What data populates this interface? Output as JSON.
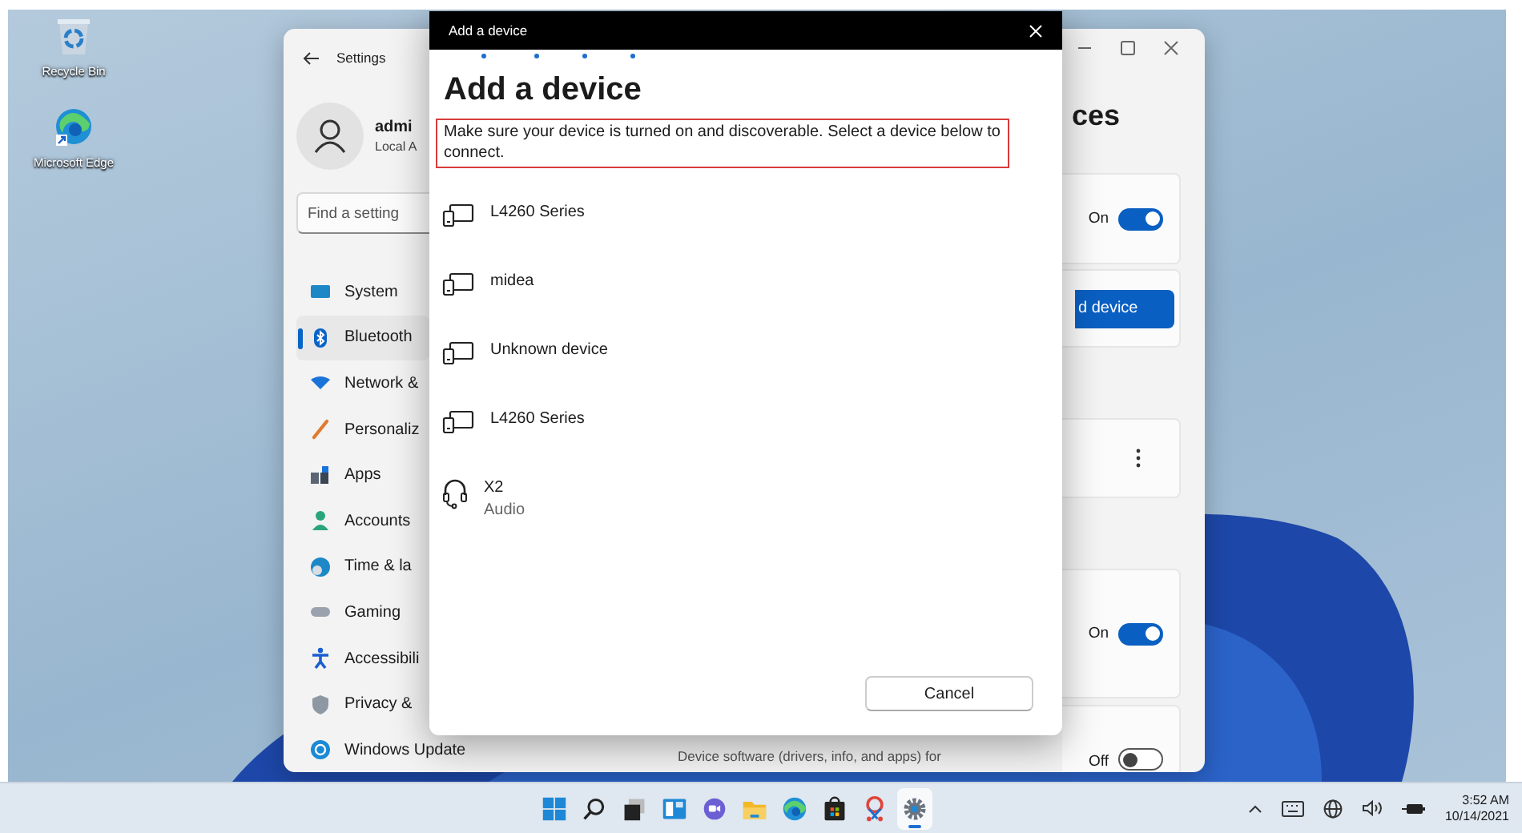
{
  "desktop": {
    "icons": [
      {
        "label": "Recycle Bin",
        "kind": "recycle"
      },
      {
        "label": "Microsoft Edge",
        "kind": "edge"
      }
    ]
  },
  "settings_window": {
    "title": "Settings",
    "user": {
      "name": "admi",
      "account": "Local A"
    },
    "search": {
      "placeholder": "Find a setting"
    },
    "nav": [
      {
        "label": "System",
        "kind": "system",
        "selected": false
      },
      {
        "label": "Bluetooth",
        "kind": "bluetooth",
        "selected": true
      },
      {
        "label": "Network &",
        "kind": "network",
        "selected": false
      },
      {
        "label": "Personaliz",
        "kind": "personalization",
        "selected": false
      },
      {
        "label": "Apps",
        "kind": "apps",
        "selected": false
      },
      {
        "label": "Accounts",
        "kind": "accounts",
        "selected": false
      },
      {
        "label": "Time & la",
        "kind": "time",
        "selected": false
      },
      {
        "label": "Gaming",
        "kind": "gaming",
        "selected": false
      },
      {
        "label": "Accessibili",
        "kind": "accessibility",
        "selected": false
      },
      {
        "label": "Privacy &",
        "kind": "privacy",
        "selected": false
      },
      {
        "label": "Windows Update",
        "kind": "update",
        "selected": false
      }
    ],
    "page_title": "ces",
    "cards": [
      {
        "kind": "toggle",
        "state_label": "On",
        "on": true
      },
      {
        "kind": "button",
        "label": "d device"
      },
      {
        "kind": "menu"
      },
      {
        "kind": "toggle",
        "state_label": "On",
        "on": true
      },
      {
        "kind": "toggle",
        "state_label": "Off",
        "on": false
      }
    ],
    "description_text": "Device software (drivers, info, and apps) for"
  },
  "dialog": {
    "title": "Add a device",
    "heading": "Add a device",
    "instructions": {
      "text": "Make sure your device is turned on and discoverable. Select a device below to connect.",
      "highlighted": true
    },
    "devices": [
      {
        "name": "L4260 Series",
        "kind": "display"
      },
      {
        "name": "midea",
        "kind": "display"
      },
      {
        "name": "Unknown device",
        "kind": "display"
      },
      {
        "name": "L4260 Series",
        "kind": "display"
      },
      {
        "name": "X2",
        "subtitle": "Audio",
        "kind": "headset"
      }
    ],
    "cancel": "Cancel"
  },
  "taskbar": {
    "apps": [
      {
        "kind": "start",
        "selected": false
      },
      {
        "kind": "search",
        "selected": false
      },
      {
        "kind": "taskview",
        "selected": false
      },
      {
        "kind": "widgets",
        "selected": false
      },
      {
        "kind": "chat",
        "selected": false
      },
      {
        "kind": "explorer",
        "selected": false
      },
      {
        "kind": "edge",
        "selected": false
      },
      {
        "kind": "store",
        "selected": false
      },
      {
        "kind": "snip",
        "selected": false
      },
      {
        "kind": "settings",
        "selected": true
      }
    ],
    "time": "3:52 AM",
    "date": "10/14/2021"
  }
}
